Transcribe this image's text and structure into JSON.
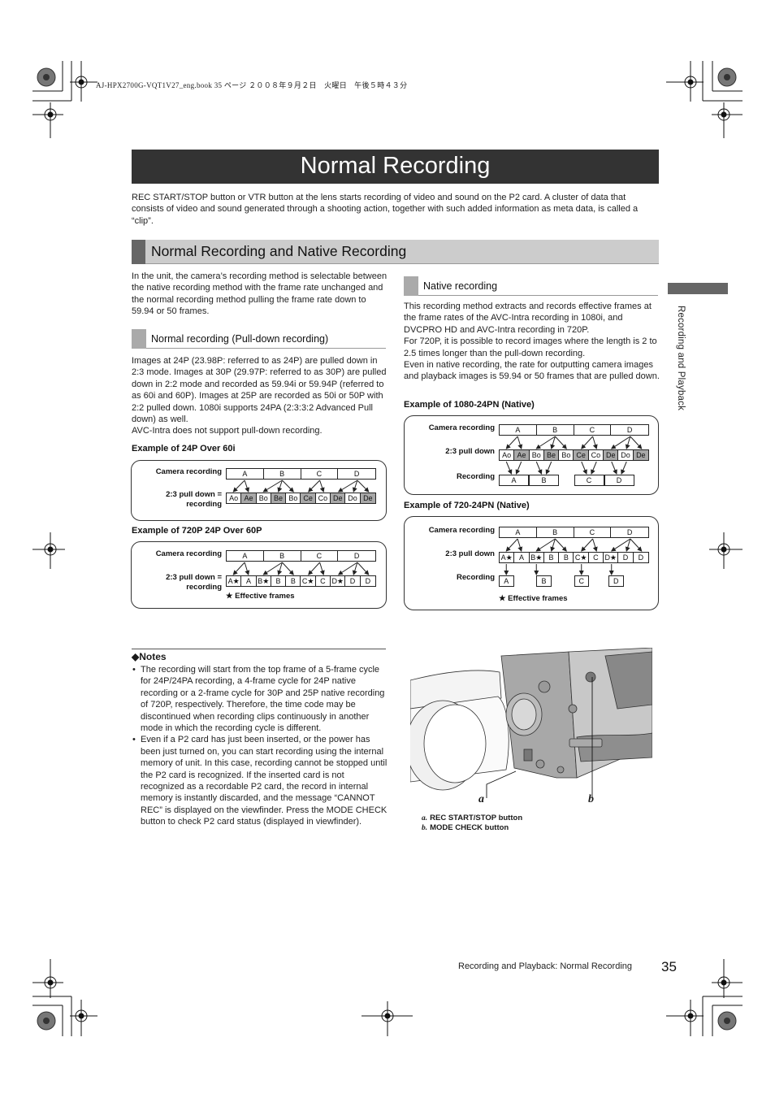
{
  "print_header": "AJ-HPX2700G-VQT1V27_eng.book  35 ページ  ２００８年９月２日　火曜日　午後５時４３分",
  "title": "Normal Recording",
  "intro": "REC START/STOP button or VTR button at the lens starts recording of video and sound on the P2 card. A cluster of data that consists of video and sound generated through a shooting action, together with such added information as meta data, is called a “clip”.",
  "section": {
    "heading": "Normal Recording and Native Recording",
    "left_intro": "In the unit, the camera’s recording method is selectable between the native recording method with the frame rate unchanged and the normal recording method pulling the frame rate down to 59.94 or 50 frames.",
    "normal": {
      "subheading": "Normal recording (Pull-down recording)",
      "body": "Images at 24P (23.98P: referred to as 24P) are pulled down in 2:3 mode. Images at 30P (29.97P: referred to as 30P) are pulled down in 2:2 mode and recorded as 59.94i or 59.94P (referred to as 60i and 60P). Images at 25P are recorded as 50i or 50P with 2:2 pulled down. 1080i supports 24PA (2:3:3:2 Advanced Pull down) as well.",
      "body2": "AVC-Intra does not support pull-down recording."
    },
    "native": {
      "subheading": "Native recording",
      "body": "This recording method extracts and records effective frames at the frame rates of the AVC-Intra recording in 1080i, and DVCPRO HD and AVC-Intra recording in 720P.",
      "body2": "For 720P, it is possible to record images where the length is 2 to 2.5 times longer than the pull-down recording.",
      "body3": "Even in native recording, the rate for outputting camera images and playback images is 59.94 or 50 frames that are pulled down."
    }
  },
  "diagrams": {
    "d1": {
      "title": "Example of 24P Over 60i",
      "row1_label": "Camera recording",
      "row2_label": "2:3 pull down =\nrecording",
      "camera": [
        "A",
        "B",
        "C",
        "D"
      ],
      "pulldown": [
        {
          "t": "Ao",
          "shade": false
        },
        {
          "t": "Ae",
          "shade": true
        },
        {
          "t": "Bo",
          "shade": false
        },
        {
          "t": "Be",
          "shade": true
        },
        {
          "t": "Bo",
          "shade": false
        },
        {
          "t": "Ce",
          "shade": true
        },
        {
          "t": "Co",
          "shade": false
        },
        {
          "t": "De",
          "shade": true
        },
        {
          "t": "Do",
          "shade": false
        },
        {
          "t": "De",
          "shade": true
        }
      ]
    },
    "d2": {
      "title": "Example of 720P 24P Over 60P",
      "row1_label": "Camera recording",
      "row2_label": "2:3 pull down =\nrecording",
      "camera": [
        "A",
        "B",
        "C",
        "D"
      ],
      "pulldown": [
        {
          "t": "A★",
          "shade": false
        },
        {
          "t": "A",
          "shade": false
        },
        {
          "t": "B★",
          "shade": false
        },
        {
          "t": "B",
          "shade": false
        },
        {
          "t": "B",
          "shade": false
        },
        {
          "t": "C★",
          "shade": false
        },
        {
          "t": "C",
          "shade": false
        },
        {
          "t": "D★",
          "shade": false
        },
        {
          "t": "D",
          "shade": false
        },
        {
          "t": "D",
          "shade": false
        }
      ],
      "legend": "★ Effective frames"
    },
    "d3": {
      "title": "Example of 1080-24PN (Native)",
      "row1_label": "Camera recording",
      "row2_label": "2:3 pull down",
      "row3_label": "Recording",
      "camera": [
        "A",
        "B",
        "C",
        "D"
      ],
      "pulldown": [
        {
          "t": "Ao",
          "shade": false
        },
        {
          "t": "Ae",
          "shade": true
        },
        {
          "t": "Bo",
          "shade": false
        },
        {
          "t": "Be",
          "shade": true
        },
        {
          "t": "Bo",
          "shade": false
        },
        {
          "t": "Ce",
          "shade": true
        },
        {
          "t": "Co",
          "shade": false
        },
        {
          "t": "De",
          "shade": true
        },
        {
          "t": "Do",
          "shade": false
        },
        {
          "t": "De",
          "shade": true
        }
      ],
      "recording": [
        "A",
        "B",
        "C",
        "D"
      ]
    },
    "d4": {
      "title": "Example of 720-24PN (Native)",
      "row1_label": "Camera recording",
      "row2_label": "2:3 pull down",
      "row3_label": "Recording",
      "camera": [
        "A",
        "B",
        "C",
        "D"
      ],
      "pulldown": [
        {
          "t": "A★",
          "shade": false
        },
        {
          "t": "A",
          "shade": false
        },
        {
          "t": "B★",
          "shade": false
        },
        {
          "t": "B",
          "shade": false
        },
        {
          "t": "B",
          "shade": false
        },
        {
          "t": "C★",
          "shade": false
        },
        {
          "t": "C",
          "shade": false
        },
        {
          "t": "D★",
          "shade": false
        },
        {
          "t": "D",
          "shade": false
        },
        {
          "t": "D",
          "shade": false
        }
      ],
      "recording": [
        "A",
        "B",
        "C",
        "D"
      ],
      "legend": "★ Effective frames"
    }
  },
  "notes": {
    "title": "◆Notes",
    "items": [
      "The recording will start from the top frame of a 5-frame cycle for 24P/24PA recording, a 4-frame cycle for 24P native recording or a 2-frame cycle for 30P and 25P native recording of 720P, respectively. Therefore, the time code may be discontinued when recording clips continuously in another mode in which the recording cycle is different.",
      "Even if a P2 card has just been inserted, or the power has been just turned on, you can start recording using the internal memory of unit. In this case, recording cannot be stopped until the P2 card is recognized. If the inserted card is not recognized as a recordable P2 card, the record in internal memory is instantly discarded, and the message “CANNOT REC” is displayed on the viewfinder. Press the MODE CHECK button to check P2 card status (displayed in viewfinder)."
    ]
  },
  "figure": {
    "callout_a": "a",
    "callout_b": "b",
    "caption_a_letter": "a.",
    "caption_a": "REC START/STOP button",
    "caption_b_letter": "b.",
    "caption_b": "MODE CHECK button"
  },
  "side_tab": "Recording and Playback",
  "footer": {
    "text": "Recording and Playback: Normal Recording",
    "page": "35"
  }
}
